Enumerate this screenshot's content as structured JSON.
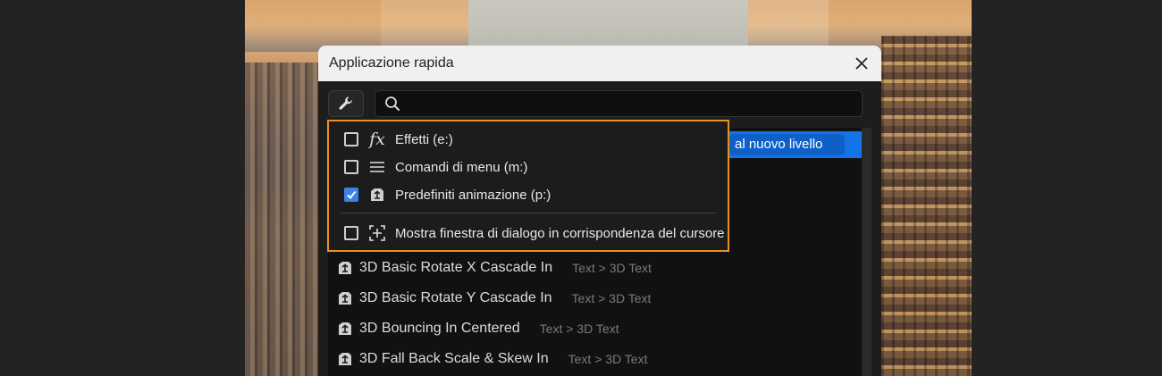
{
  "dialog": {
    "title": "Applicazione rapida",
    "search": {
      "value": "",
      "placeholder": ""
    }
  },
  "selected_row": {
    "visible_text": "al nuovo livello"
  },
  "menu": {
    "items": [
      {
        "label": "Effetti (e:)",
        "checked": false,
        "icon": "fx-icon"
      },
      {
        "label": "Comandi di menu (m:)",
        "checked": false,
        "icon": "menu-lines-icon"
      },
      {
        "label": "Predefiniti animazione (p:)",
        "checked": true,
        "icon": "animation-preset-icon"
      }
    ],
    "cursor_option": {
      "label": "Mostra finestra di dialogo in corrispondenza del cursore",
      "checked": false,
      "icon": "crosshair-icon"
    }
  },
  "results": [
    {
      "name": "3D Basic Rotate X Cascade In",
      "category": "Text > 3D Text",
      "icon": "animation-preset-icon"
    },
    {
      "name": "3D Basic Rotate Y Cascade In",
      "category": "Text > 3D Text",
      "icon": "animation-preset-icon"
    },
    {
      "name": "3D Bouncing In Centered",
      "category": "Text > 3D Text",
      "icon": "animation-preset-icon"
    },
    {
      "name": "3D Fall Back Scale & Skew In",
      "category": "Text > 3D Text",
      "icon": "animation-preset-icon"
    }
  ],
  "colors": {
    "accent": "#1473e6",
    "highlight_border": "#e8911f",
    "checkbox_checked": "#3b82e6"
  }
}
